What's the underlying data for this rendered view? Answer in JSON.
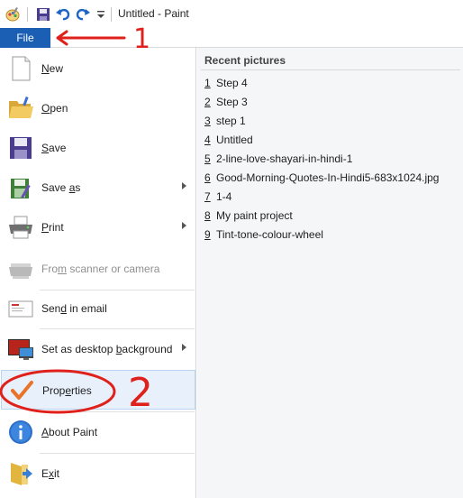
{
  "window": {
    "title": "Untitled - Paint"
  },
  "ribbon": {
    "file_tab": "File"
  },
  "menu": {
    "items": [
      {
        "label": "New",
        "accel": "N"
      },
      {
        "label": "Open",
        "accel": "O"
      },
      {
        "label": "Save",
        "accel": "S"
      },
      {
        "label": "Save as",
        "accel": "a"
      },
      {
        "label": "Print",
        "accel": "P"
      },
      {
        "label": "From scanner or camera",
        "accel": "m"
      },
      {
        "label": "Send in email",
        "accel": "d"
      },
      {
        "label": "Set as desktop background",
        "accel": "b"
      },
      {
        "label": "Properties",
        "accel": "e"
      },
      {
        "label": "About Paint",
        "accel": "A"
      },
      {
        "label": "Exit",
        "accel": "x"
      }
    ]
  },
  "recent": {
    "heading": "Recent pictures",
    "items": [
      {
        "num": "1",
        "name": "Step 4"
      },
      {
        "num": "2",
        "name": "Step 3"
      },
      {
        "num": "3",
        "name": "step 1"
      },
      {
        "num": "4",
        "name": "Untitled"
      },
      {
        "num": "5",
        "name": "2-line-love-shayari-in-hindi-1"
      },
      {
        "num": "6",
        "name": "Good-Morning-Quotes-In-Hindi5-683x1024.jpg"
      },
      {
        "num": "7",
        "name": "1-4"
      },
      {
        "num": "8",
        "name": "My paint project"
      },
      {
        "num": "9",
        "name": "Tint-tone-colour-wheel"
      }
    ]
  },
  "annotations": {
    "step1": "1",
    "step2": "2",
    "color": "#e0201b"
  },
  "colors": {
    "file_tab": "#1a5fb4",
    "highlight": "#e8f1fb",
    "highlight_border": "#b9d4f1"
  },
  "icons": [
    "paint-app-icon",
    "save-icon",
    "undo-icon",
    "redo-icon",
    "customize-dropdown-icon",
    "new-icon",
    "open-icon",
    "save-icon",
    "save-as-icon",
    "print-icon",
    "scanner-icon",
    "email-icon",
    "desktop-background-icon",
    "properties-icon",
    "about-icon",
    "exit-icon"
  ]
}
